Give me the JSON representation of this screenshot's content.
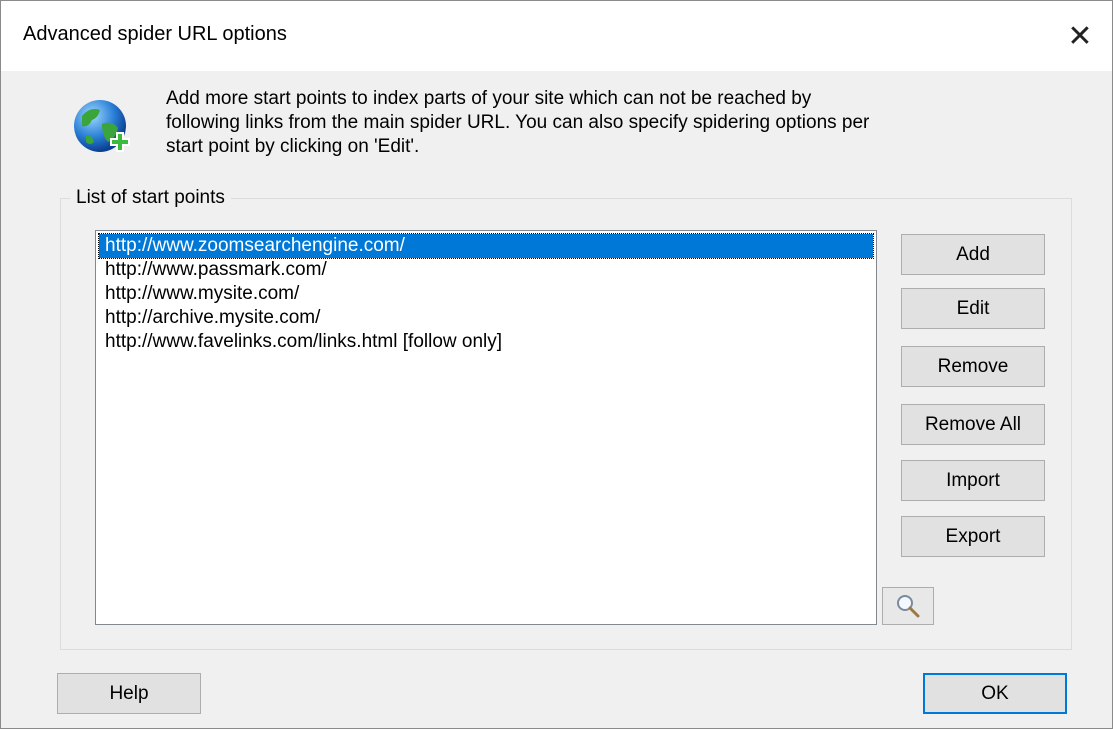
{
  "dialog": {
    "title": "Advanced spider URL options",
    "close_symbol": "✕"
  },
  "description": "Add more start points to index parts of your site which can not be reached by following links from the main spider URL. You can also specify spidering options per start point by clicking on 'Edit'.",
  "group": {
    "label": "List of start points"
  },
  "start_points": [
    "http://www.zoomsearchengine.com/",
    "http://www.passmark.com/",
    "http://www.mysite.com/",
    "http://archive.mysite.com/",
    "http://www.favelinks.com/links.html [follow only]"
  ],
  "selected_index": 0,
  "buttons": {
    "add": "Add",
    "edit": "Edit",
    "remove": "Remove",
    "remove_all": "Remove All",
    "import": "Import",
    "export": "Export",
    "help": "Help",
    "ok": "OK"
  },
  "icons": {
    "globe": "globe-add-icon",
    "magnifier": "magnifier-icon"
  },
  "colors": {
    "selection": "#0078d7",
    "default_button_border": "#0078d7"
  }
}
